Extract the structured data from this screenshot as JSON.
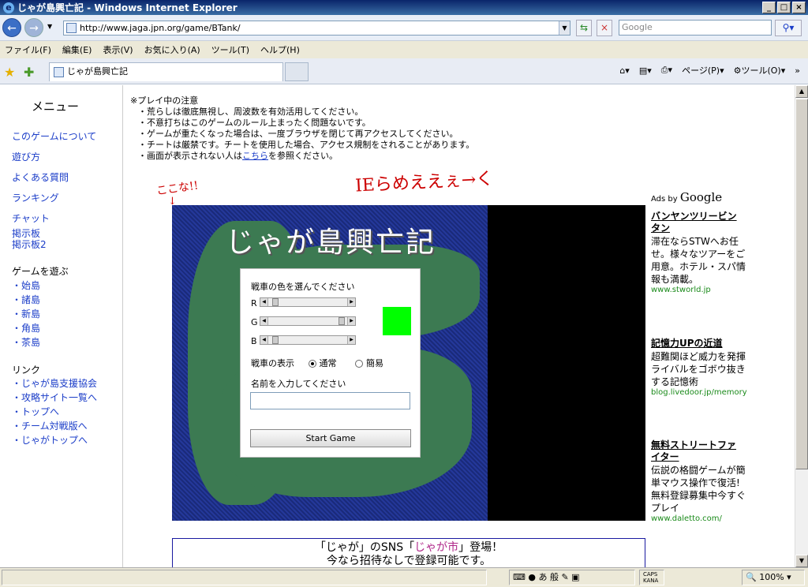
{
  "window": {
    "title": "じゃが島興亡記 - Windows Internet Explorer"
  },
  "address": {
    "url": "http://www.jaga.jpn.org/game/BTank/",
    "search_placeholder": "Google"
  },
  "menu": [
    "ファイル(F)",
    "編集(E)",
    "表示(V)",
    "お気に入り(A)",
    "ツール(T)",
    "ヘルプ(H)"
  ],
  "tab": {
    "label": "じゃが島興亡記"
  },
  "command": {
    "page": "ページ(P)",
    "tools": "ツール(O)"
  },
  "sidebar": {
    "title": "メニュー",
    "links": [
      "このゲームについて",
      "遊び方",
      "よくある質問",
      "ランキング",
      "チャット",
      "掲示板",
      "掲示板2"
    ],
    "games_header": "ゲームを遊ぶ",
    "games": [
      "始島",
      "諸島",
      "新島",
      "角島",
      "茶島"
    ],
    "links_header": "リンク",
    "ext_links": [
      "じゃが島支援協会",
      "攻略サイト一覧へ",
      "トップへ",
      "チーム対戦版へ",
      "じゃがトップへ"
    ]
  },
  "notes": {
    "header": "※プレイ中の注意",
    "lines": [
      "・荒らしは徹底無視し、周波数を有効活用してください。",
      "・不意打ちはこのゲームのルール上まったく問題ないです。",
      "・ゲームが重たくなった場合は、一度ブラウザを閉じて再アクセスしてください。",
      "・チートは厳禁です。チートを使用した場合、アクセス規制をされることがあります。"
    ],
    "last_pre": "・画面が表示されない人は",
    "last_link": "こちら",
    "last_post": "を参照ください。"
  },
  "annotations": {
    "here": "ここな!!",
    "ie": "IEらめええぇ→く"
  },
  "game": {
    "title": "じゃが島興亡記",
    "color_label": "戦車の色を選んでください",
    "r": "R",
    "g": "G",
    "b": "B",
    "r_level": 0.05,
    "g_level": 0.95,
    "b_level": 0.05,
    "swatch": "#00ff00",
    "display_label": "戦車の表示",
    "opt_normal": "通常",
    "opt_simple": "簡易",
    "name_label": "名前を入力してください",
    "start": "Start Game"
  },
  "ads": {
    "header_prefix": "Ads by",
    "header_brand": "Google",
    "items": [
      {
        "title": "バンヤンツリービンタン",
        "body": "滞在ならSTWへお任せ。様々なツアーをご用意。ホテル・スパ情報も満載。",
        "url": "www.stworld.jp"
      },
      {
        "title": "記憶力UPの近道",
        "body": "超難関ほど威力を発揮 ライバルをゴボウ抜きする記憶術",
        "url": "blog.livedoor.jp/memory"
      },
      {
        "title": "無料ストリートファイター",
        "body": "伝説の格闘ゲームが簡単マウス操作で復活!無料登録募集中今すぐプレイ",
        "url": "www.daletto.com/"
      }
    ]
  },
  "banner": {
    "l1_a": "「じゃが」のSNS「",
    "l1_b": "じゃが市",
    "l1_c": "」登場！",
    "l2": "今なら招待なしで登録可能です。"
  },
  "status": {
    "zoom": "100%",
    "caps": "CAPS",
    "kana": "KANA",
    "ime_a": "あ",
    "ime_b": "般"
  }
}
